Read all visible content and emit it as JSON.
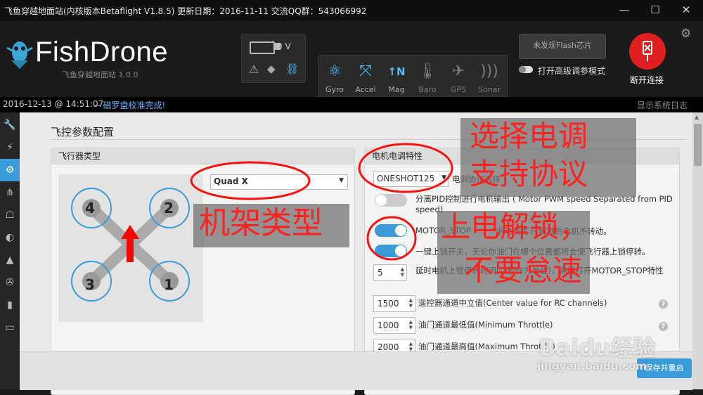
{
  "window": {
    "title": "飞鱼穿越地面站(内核版本Betaflight V1.8.5)  更新日期：2016-11-11  交流QQ群：543066992",
    "minimize": "—",
    "maximize": "☐",
    "close": "✕"
  },
  "header": {
    "logo": "FishDrone",
    "subtitle": "飞鱼穿越地面站    1.0.0",
    "battery_voltage": "0 V",
    "sensors": [
      {
        "label": "Gyro",
        "icon": "gyro-icon",
        "active": true
      },
      {
        "label": "Accel",
        "icon": "accel-icon",
        "active": true
      },
      {
        "label": "Mag",
        "icon": "mag-icon",
        "active": true
      },
      {
        "label": "Baro",
        "icon": "baro-icon",
        "active": false
      },
      {
        "label": "GPS",
        "icon": "gps-icon",
        "active": false
      },
      {
        "label": "Sonar",
        "icon": "sonar-icon",
        "active": false
      }
    ],
    "flash_button": "未发现Flash芯片",
    "expert_mode_label": "打开高级调参模式",
    "connect_label": "断开连接"
  },
  "status": {
    "timestamp": "2016-12-13 @ 14:51:07",
    "message": "-- 磁罗盘校准完成!",
    "show_log": "显示系统日志"
  },
  "content": {
    "page_title": "飞控参数配置",
    "frame_card": {
      "title": "飞行器类型",
      "frame_type": "Quad X",
      "motors": [
        "4",
        "2",
        "3",
        "1"
      ]
    },
    "esc_card": {
      "title": "电机电调特性",
      "protocol_value": "ONESHOT125",
      "protocol_label": "电调协议选择",
      "separate_pid_label": "分离PID控制进行电机输出 ( Motor PWM speed Separated from PID speed)",
      "separate_pid_on": false,
      "motor_stop_label": "MOTOR_STOP",
      "motor_stop_desc": "手动模式下,解锁后电机不转动。",
      "motor_stop_on": true,
      "autodisarm_desc": "一键上锁开关，无论你油门在哪个位置都将会使飞行器上锁停转。",
      "autodisarm_on": true,
      "disarm_delay": "5",
      "disarm_delay_label": "延时电机上锁停转时间(以秒作为单位)，需要打开MOTOR_STOP特性",
      "mid_rc": "1500",
      "mid_rc_label": "遥控器通道中立值(Center value for RC channels)",
      "min_throttle": "1000",
      "min_throttle_label": "油门通道最低值(Minimum Throttle)",
      "max_throttle": "2000",
      "max_throttle_label": "油门通道最高值(Maximum Throttle)",
      "help": "?"
    },
    "save_button": "保存并重启"
  },
  "annotations": {
    "select_esc_line1": "选择电调",
    "select_esc_line2": "支持协议",
    "frame_type": "机架类型",
    "power_unlock_line1": "上电解锁，",
    "power_unlock_line2": "不要怠速"
  },
  "watermark": {
    "brand": "Baidu经验",
    "url": "jingyan.baidu.com"
  },
  "colors": {
    "accent": "#3a9bd9",
    "annotation": "#ff2020",
    "connect": "#e02020"
  }
}
